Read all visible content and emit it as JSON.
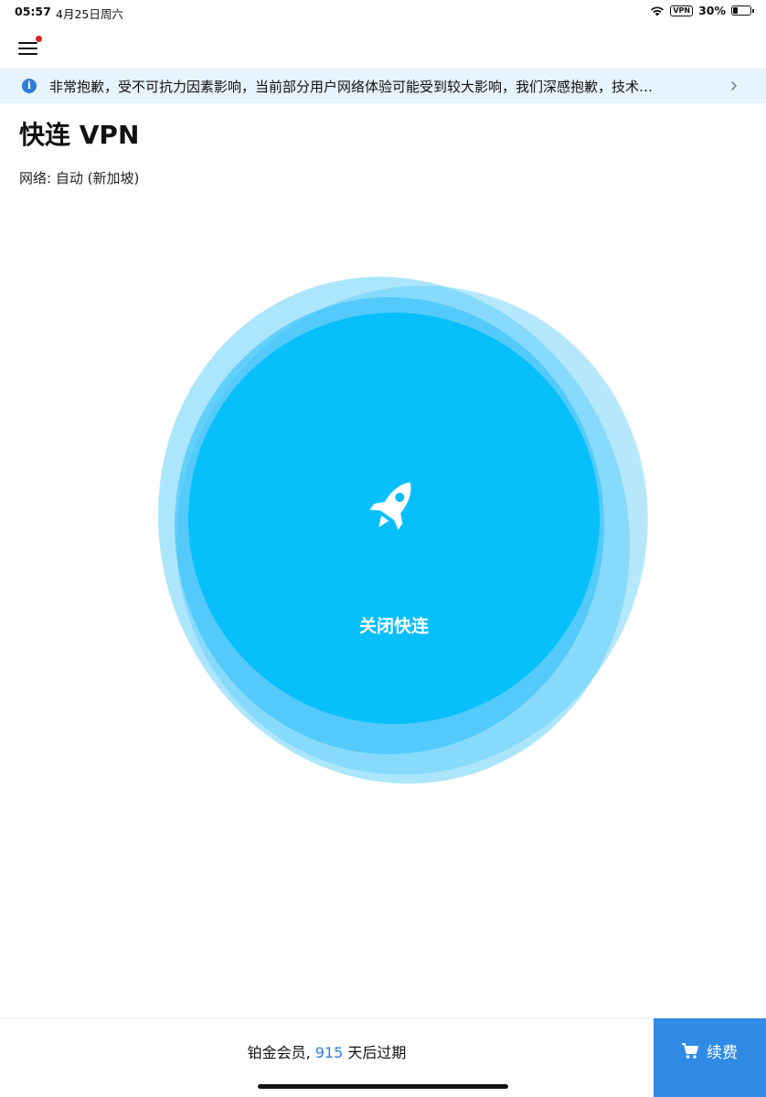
{
  "status_bar": {
    "time": "05:57",
    "date": "4月25日周六",
    "vpn_badge": "VPN",
    "battery": "30%",
    "battery_level": 0.3
  },
  "notice": {
    "icon": "info-icon",
    "text": "非常抱歉，受不可抗力因素影响，当前部分用户网络体验可能受到较大影响，我们深感抱歉，技术…"
  },
  "header": {
    "title": "快连 VPN",
    "network": "网络: 自动 (新加坡)"
  },
  "connect": {
    "icon": "rocket-icon",
    "label": "关闭快连",
    "color": "#06bffb"
  },
  "footer": {
    "membership_prefix": "铂金会员, ",
    "days": "915",
    "membership_suffix": " 天后过期",
    "renew_label": "续费",
    "renew_color": "#2f8be6"
  }
}
